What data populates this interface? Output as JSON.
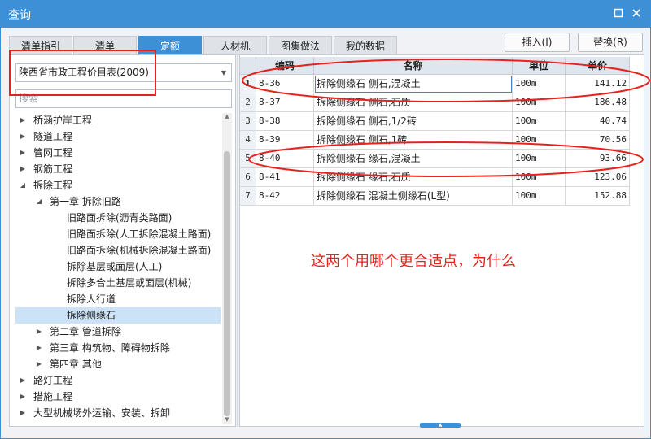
{
  "window": {
    "title": "查询",
    "maximize_icon": "square-icon",
    "close_icon": "close-icon"
  },
  "tabs": [
    {
      "label": "清单指引"
    },
    {
      "label": "清单"
    },
    {
      "label": "定额",
      "active": true
    },
    {
      "label": "人材机"
    },
    {
      "label": "图集做法"
    },
    {
      "label": "我的数据"
    }
  ],
  "buttons": {
    "insert": "插入(I)",
    "replace": "替换(R)"
  },
  "library": {
    "selected": "陕西省市政工程价目表(2009)"
  },
  "search": {
    "placeholder": "搜索"
  },
  "tree": [
    {
      "label": "桥涵护岸工程",
      "level": 0,
      "toggle": "collapsed"
    },
    {
      "label": "隧道工程",
      "level": 0,
      "toggle": "collapsed"
    },
    {
      "label": "管网工程",
      "level": 0,
      "toggle": "collapsed"
    },
    {
      "label": "钢筋工程",
      "level": 0,
      "toggle": "collapsed"
    },
    {
      "label": "拆除工程",
      "level": 0,
      "toggle": "expanded"
    },
    {
      "label": "第一章 拆除旧路",
      "level": 1,
      "toggle": "expanded"
    },
    {
      "label": "旧路面拆除(沥青类路面)",
      "level": 2,
      "toggle": "none"
    },
    {
      "label": "旧路面拆除(人工拆除混凝土路面)",
      "level": 2,
      "toggle": "none"
    },
    {
      "label": "旧路面拆除(机械拆除混凝土路面)",
      "level": 2,
      "toggle": "none"
    },
    {
      "label": "拆除基层或面层(人工)",
      "level": 2,
      "toggle": "none"
    },
    {
      "label": "拆除多合土基层或面层(机械)",
      "level": 2,
      "toggle": "none"
    },
    {
      "label": "拆除人行道",
      "level": 2,
      "toggle": "none"
    },
    {
      "label": "拆除侧缘石",
      "level": 2,
      "toggle": "none",
      "selected": true
    },
    {
      "label": "第二章 管道拆除",
      "level": 1,
      "toggle": "collapsed"
    },
    {
      "label": "第三章 构筑物、障碍物拆除",
      "level": 1,
      "toggle": "collapsed"
    },
    {
      "label": "第四章 其他",
      "level": 1,
      "toggle": "collapsed"
    },
    {
      "label": "路灯工程",
      "level": 0,
      "toggle": "collapsed"
    },
    {
      "label": "措施工程",
      "level": 0,
      "toggle": "collapsed"
    },
    {
      "label": "大型机械场外运输、安装、拆卸",
      "level": 0,
      "toggle": "collapsed"
    }
  ],
  "table": {
    "columns": [
      "编码",
      "名称",
      "单位",
      "单价"
    ],
    "rows": [
      {
        "n": "1",
        "code": "8-36",
        "name": "拆除侧缘石 侧石,混凝土",
        "unit": "100m",
        "price": "141.12"
      },
      {
        "n": "2",
        "code": "8-37",
        "name": "拆除侧缘石 侧石,石质",
        "unit": "100m",
        "price": "186.48"
      },
      {
        "n": "3",
        "code": "8-38",
        "name": "拆除侧缘石 侧石,1/2砖",
        "unit": "100m",
        "price": "40.74"
      },
      {
        "n": "4",
        "code": "8-39",
        "name": "拆除侧缘石 侧石,1砖",
        "unit": "100m",
        "price": "70.56"
      },
      {
        "n": "5",
        "code": "8-40",
        "name": "拆除侧缘石 缘石,混凝土",
        "unit": "100m",
        "price": "93.66"
      },
      {
        "n": "6",
        "code": "8-41",
        "name": "拆除侧缘石 缘石,石质",
        "unit": "100m",
        "price": "123.06"
      },
      {
        "n": "7",
        "code": "8-42",
        "name": "拆除侧缘石 混凝土侧缘石(L型)",
        "unit": "100m",
        "price": "152.88"
      }
    ]
  },
  "annotation": {
    "question": "这两个用哪个更合适点，为什么",
    "color": "#e8211d"
  },
  "colors": {
    "accent": "#3d8fd6",
    "selected_row": "#cce3f7"
  }
}
